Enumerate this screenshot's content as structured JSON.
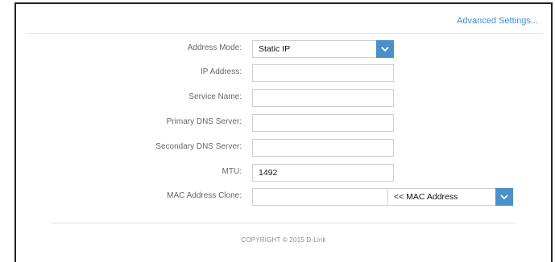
{
  "header": {
    "advanced_settings": "Advanced Settings..."
  },
  "form": {
    "address_mode": {
      "label": "Address Mode:",
      "value": "Static IP"
    },
    "ip_address": {
      "label": "IP Address:",
      "value": ""
    },
    "service_name": {
      "label": "Service Name:",
      "value": ""
    },
    "primary_dns": {
      "label": "Primary DNS Server:",
      "value": ""
    },
    "secondary_dns": {
      "label": "Secondary DNS Server:",
      "value": ""
    },
    "mtu": {
      "label": "MTU:",
      "value": "1492"
    },
    "mac_clone": {
      "label": "MAC Address Clone:",
      "value": "",
      "select_value": "<< MAC Address"
    }
  },
  "footer": {
    "copyright": "COPYRIGHT © 2015 D-Link"
  },
  "colors": {
    "accent": "#4a90c9",
    "link": "#3a8fd6"
  },
  "icons": [
    "chevron-down-icon"
  ]
}
